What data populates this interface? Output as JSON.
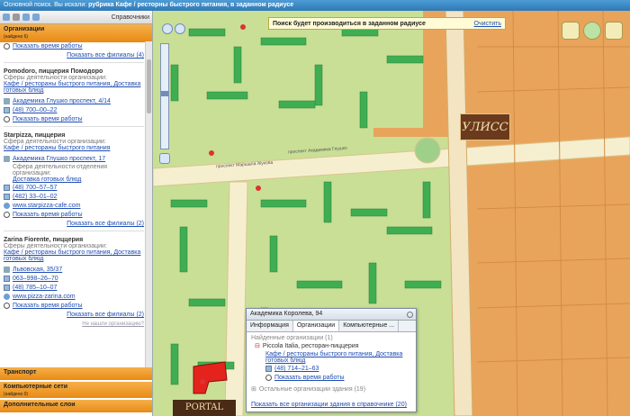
{
  "window": {
    "title_prefix": "Основной поиск. Вы искали: ",
    "title_bold": "рубрика Кафе / ресторны быстрого питания, в заданном радиусе"
  },
  "toolbar": {
    "reference_label": "Справочники"
  },
  "organizations": {
    "header": "Организации",
    "sub": "(найдено 6)",
    "top_link": "Показать время работы",
    "top_show_branches": "Показать все филиалы (4)",
    "items": [
      {
        "name": "Pomodoro, пиццерия Помодоро",
        "activity_label": "Сферы деятельности организации:",
        "activities": "Кафе / рестораны быстрого питания, Доставка готовых блюд",
        "address": "Академика Глушко проспект, 4/14",
        "phones": [
          "(48) 700–00–22"
        ],
        "hours": "Показать время работы"
      },
      {
        "name": "Starpizza, пиццерия",
        "activity_label": "Сфера деятельности организации:",
        "activities": "Кафе / рестораны быстрого питания",
        "address": "Академика Глушко проспект, 17",
        "branch_label": "Сфера деятельности отделения организации:",
        "branch_activity": "Доставка готовых блюд",
        "phones": [
          "(48) 700–57–57",
          "(482) 33–01–02"
        ],
        "web": "www.starpizza-cafe.com",
        "hours": "Показать время работы",
        "show_branches": "Показать все филиалы (2)"
      },
      {
        "name": "Zarina Fiorente, пиццерия",
        "activity_label": "Сферы деятельности организации:",
        "activities": "Кафе / рестораны быстрого питания, Доставка готовых блюд",
        "address": "Львовская, 35/37",
        "phones": [
          "063–998–26–70",
          "(48) 785–10–07"
        ],
        "web": "www.pizza-zarina.com",
        "hours": "Показать время работы",
        "show_branches": "Показать все филиалы (2)"
      }
    ],
    "not_found": "Не нашли организацию?"
  },
  "bottom_sections": [
    {
      "label": "Транспорт",
      "sub": ""
    },
    {
      "label": "Компьютерные сети",
      "sub": "(найдено 0)"
    },
    {
      "label": "Дополнительные слои",
      "sub": ""
    }
  ],
  "map": {
    "search_notice": "Поиск будет производиться в заданном радиусе",
    "clear_label": "Очистить",
    "logo_ulis": "УЛИСС",
    "logo_portal": "PORTAL",
    "streets": [
      "проспект Академика Глушко",
      "проспект Маршала Жукова"
    ]
  },
  "popup": {
    "header": "Академика Королева, 94",
    "tabs": [
      "Информация",
      "Организации",
      "Компьютерные ..."
    ],
    "active_tab": 1,
    "found_label": "Найденные организации (1)",
    "org_name": "Piccola Italia, ресторан-пиццерия",
    "org_activities": "Кафе / рестораны быстрого питания, Доставка готовых блюд",
    "org_phone": "(48) 714–21–63",
    "org_hours": "Показать время работы",
    "other_orgs": "Остальные организации здания (19)",
    "show_all": "Показать все организации здания в справочнике (20)"
  }
}
